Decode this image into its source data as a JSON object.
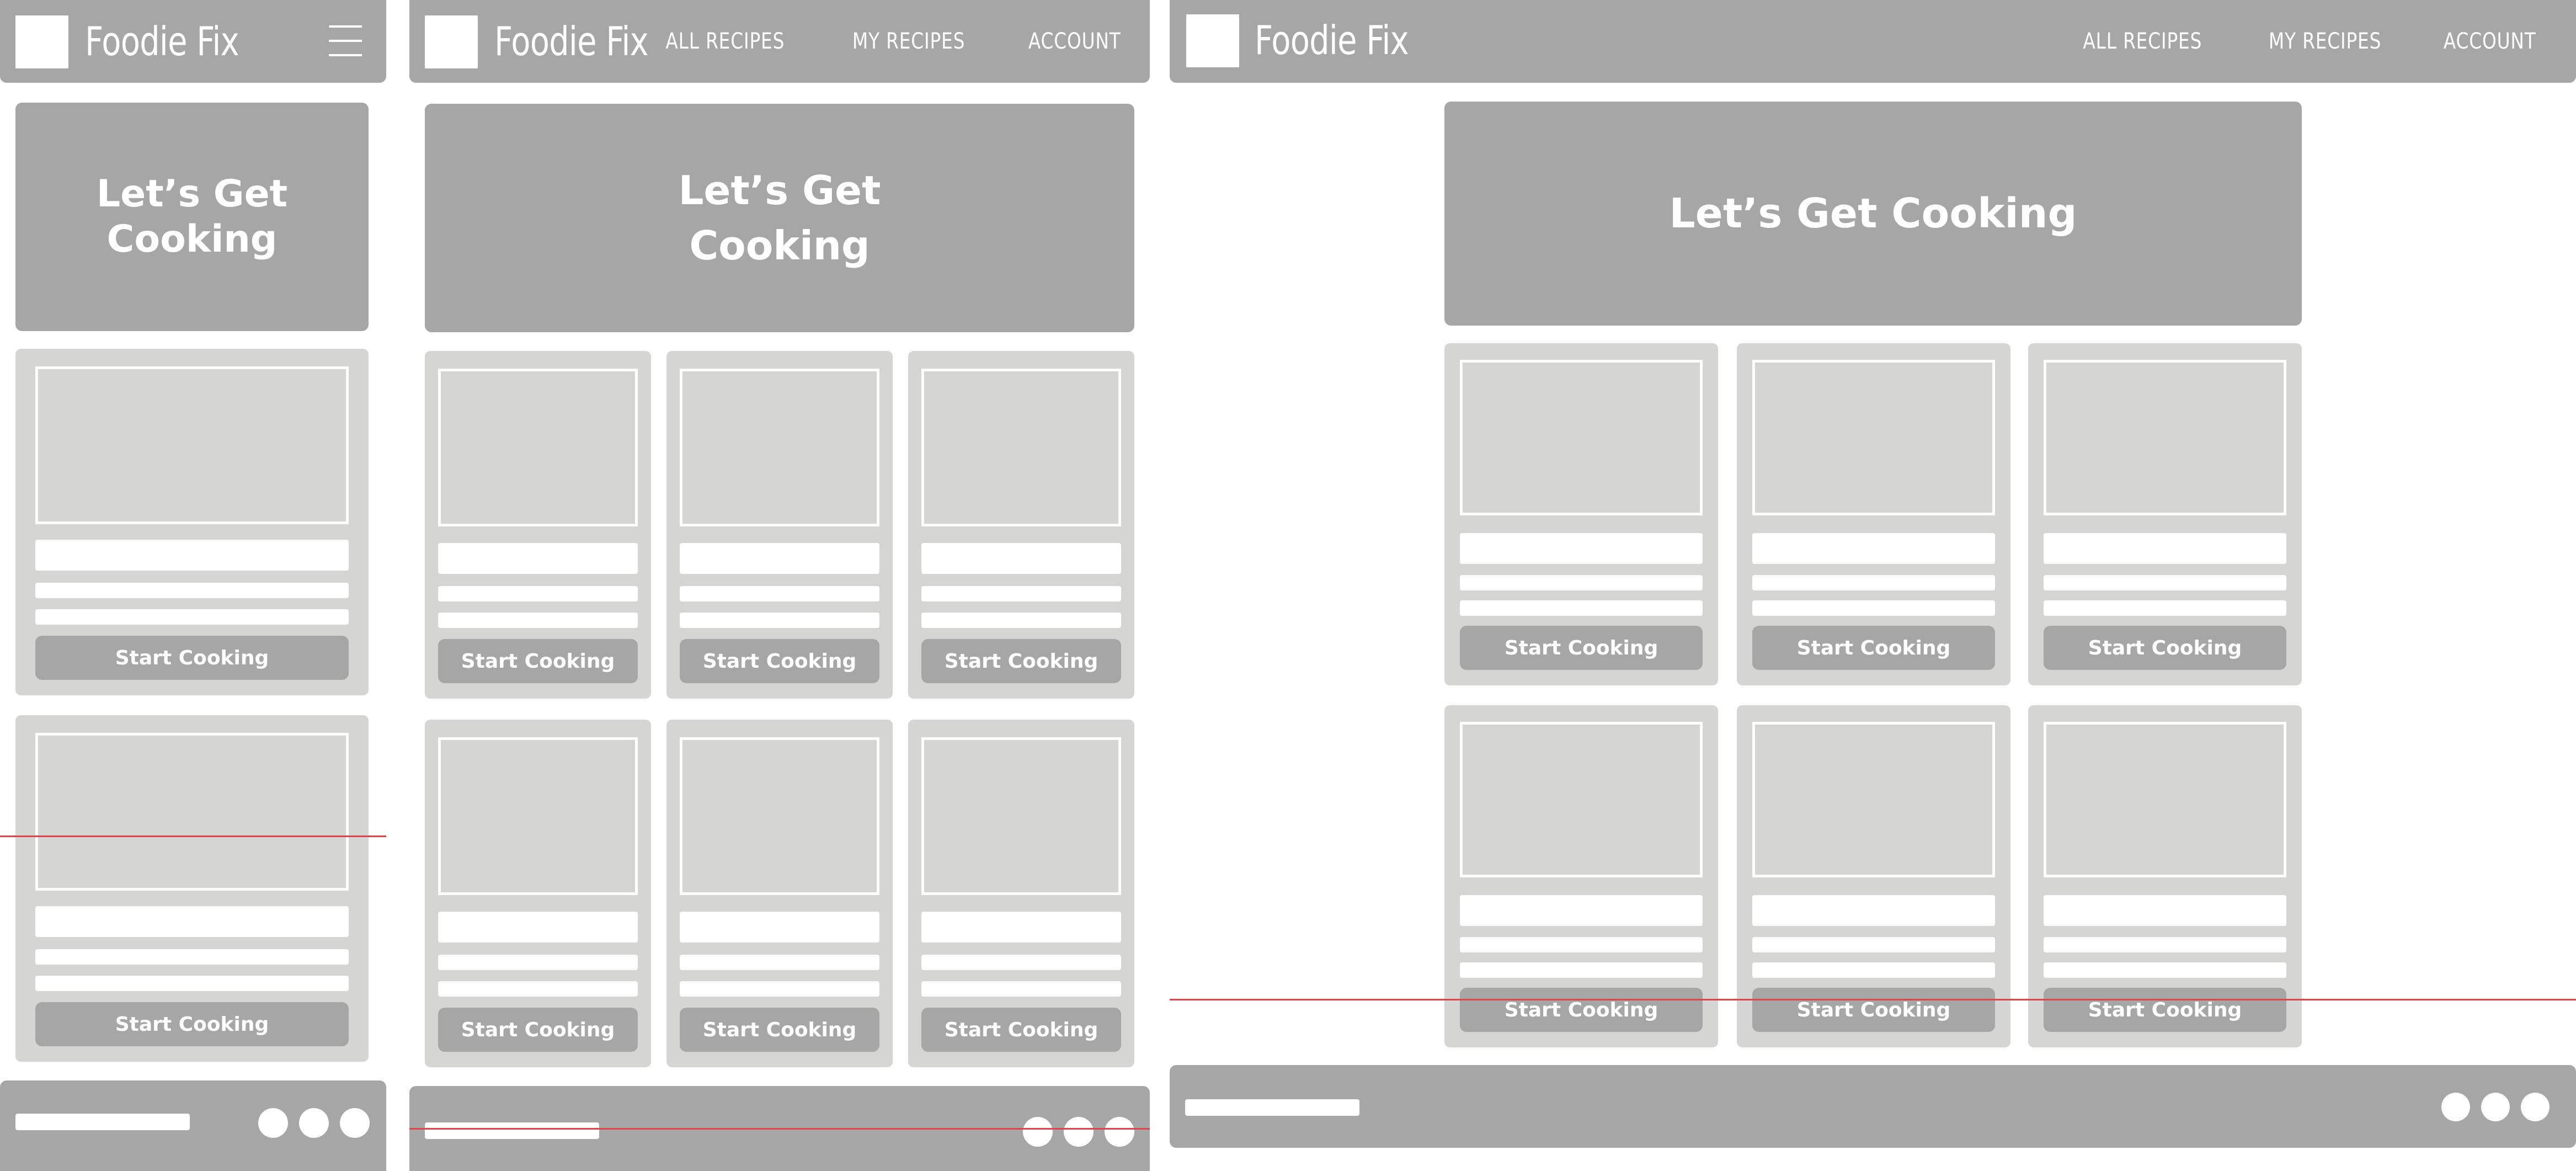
{
  "brand": {
    "name": "Foodie Fix"
  },
  "nav": {
    "all_recipes": "ALL RECIPES",
    "my_recipes": "MY RECIPES",
    "account": "ACCOUNT"
  },
  "hero": {
    "line1": "Let’s Get",
    "line2": "Cooking",
    "full": "Let’s Get Cooking"
  },
  "card": {
    "button_label": "Start Cooking"
  },
  "icons": {
    "logo": "logo-placeholder-icon",
    "menu": "hamburger-menu-icon",
    "footer_social": "social-circle-icon"
  },
  "colors": {
    "chrome": "#a6a6a6",
    "card": "#d5d5d3",
    "placeholder": "#ffffff",
    "breakpoint_line": "#e0434a"
  }
}
